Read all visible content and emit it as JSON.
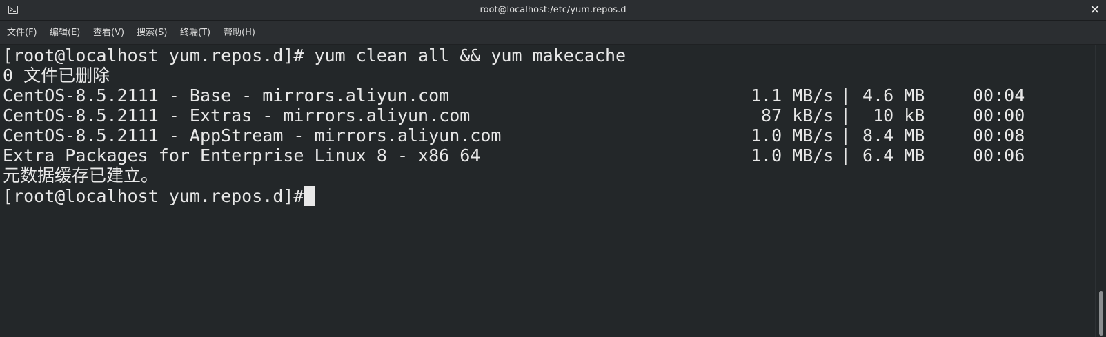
{
  "window": {
    "title": "root@localhost:/etc/yum.repos.d",
    "close_glyph": "✕"
  },
  "menu": [
    {
      "label": "文件(F)"
    },
    {
      "label": "编辑(E)"
    },
    {
      "label": "查看(V)"
    },
    {
      "label": "搜索(S)"
    },
    {
      "label": "终端(T)"
    },
    {
      "label": "帮助(H)"
    }
  ],
  "terminal": {
    "command_line": "[root@localhost yum.repos.d]# yum clean all && yum makecache",
    "removed_line": "0 文件已删除",
    "repos": [
      {
        "name": "CentOS-8.5.2111 - Base - mirrors.aliyun.com",
        "speed": "1.1 MB/s",
        "sep": "|",
        "size": "4.6 MB",
        "time": "00:04"
      },
      {
        "name": "CentOS-8.5.2111 - Extras - mirrors.aliyun.com",
        "speed": " 87 kB/s",
        "sep": "|",
        "size": " 10 kB",
        "time": "00:00"
      },
      {
        "name": "CentOS-8.5.2111 - AppStream - mirrors.aliyun.com",
        "speed": "1.0 MB/s",
        "sep": "|",
        "size": "8.4 MB",
        "time": "00:08"
      },
      {
        "name": "Extra Packages for Enterprise Linux 8 - x86_64",
        "speed": "1.0 MB/s",
        "sep": "|",
        "size": "6.4 MB",
        "time": "00:06"
      }
    ],
    "cache_line": "元数据缓存已建立。",
    "prompt": "[root@localhost yum.repos.d]# "
  },
  "colors": {
    "background": "#232729",
    "titlebar": "#2b2e31",
    "text": "#e8e8e8"
  }
}
